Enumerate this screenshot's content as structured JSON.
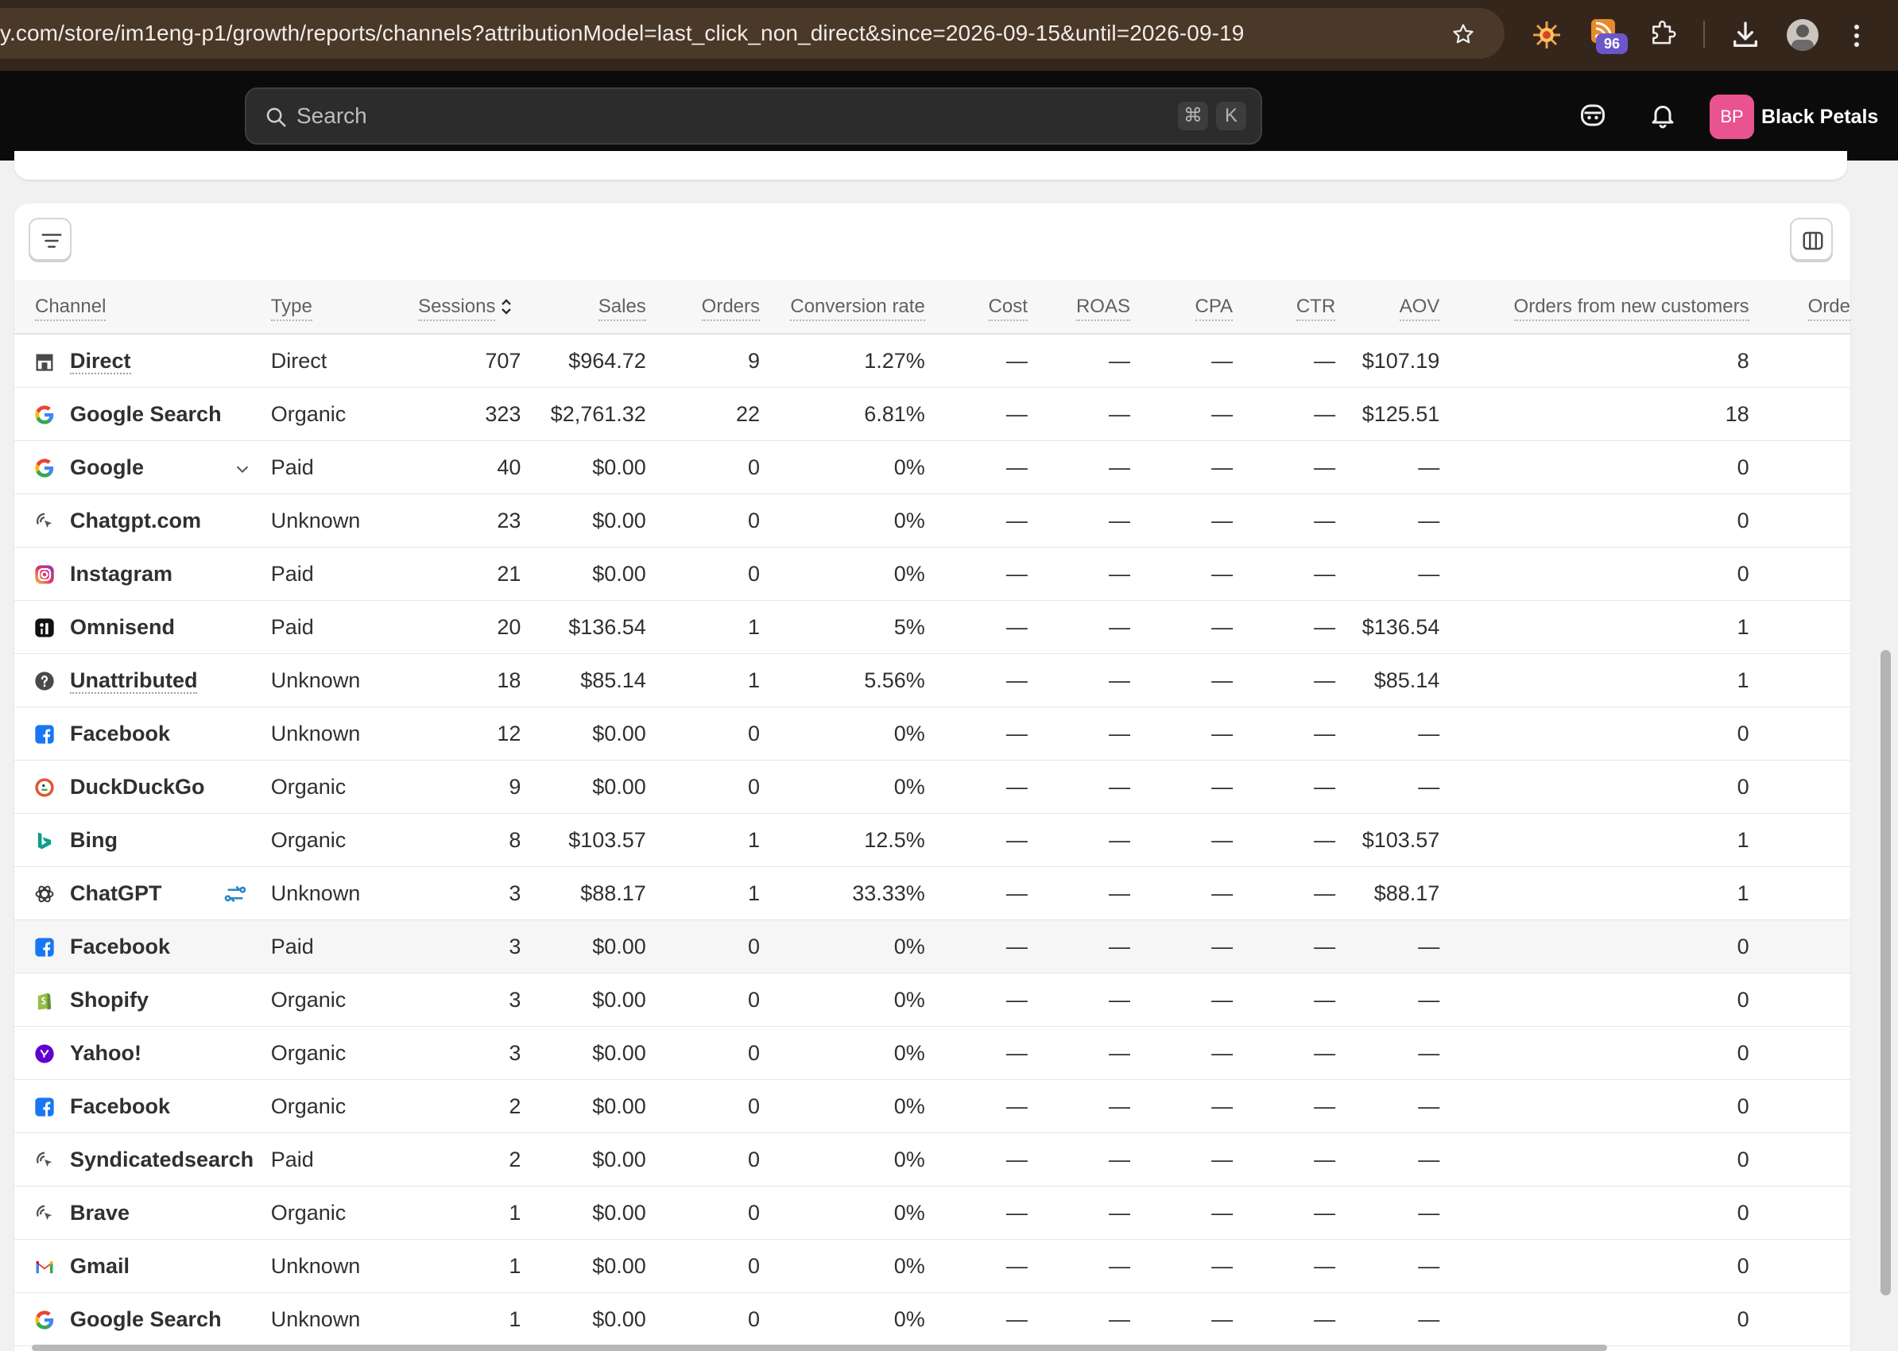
{
  "browser": {
    "url": "y.com/store/im1eng-p1/growth/reports/channels?attributionModel=last_click_non_direct&since=2026-09-15&until=2026-09-19",
    "extension_badge": "96"
  },
  "topbar": {
    "search_placeholder": "Search",
    "shortcut_cmd": "⌘",
    "shortcut_key": "K",
    "store_initials": "BP",
    "store_name": "Black Petals"
  },
  "table": {
    "columns": [
      "Channel",
      "Type",
      "Sessions",
      "Sales",
      "Orders",
      "Conversion rate",
      "Cost",
      "ROAS",
      "CPA",
      "CTR",
      "AOV",
      "Orders from new customers",
      "Orders"
    ],
    "rows": [
      {
        "icon": "store-icon",
        "channel": "Direct",
        "type": "Direct",
        "sessions": "707",
        "sales": "$964.72",
        "orders": "9",
        "conv": "1.27%",
        "cost": "—",
        "roas": "—",
        "cpa": "—",
        "ctr": "—",
        "aov": "$107.19",
        "new_orders": "8"
      },
      {
        "icon": "google-icon",
        "channel": "Google Search",
        "type": "Organic",
        "sessions": "323",
        "sales": "$2,761.32",
        "orders": "22",
        "conv": "6.81%",
        "cost": "—",
        "roas": "—",
        "cpa": "—",
        "ctr": "—",
        "aov": "$125.51",
        "new_orders": "18"
      },
      {
        "icon": "google-icon",
        "channel": "Google",
        "type": "Paid",
        "sessions": "40",
        "sales": "$0.00",
        "orders": "0",
        "conv": "0%",
        "cost": "—",
        "roas": "—",
        "cpa": "—",
        "ctr": "—",
        "aov": "—",
        "new_orders": "0"
      },
      {
        "icon": "cursor-click-icon",
        "channel": "Chatgpt.com",
        "type": "Unknown",
        "sessions": "23",
        "sales": "$0.00",
        "orders": "0",
        "conv": "0%",
        "cost": "—",
        "roas": "—",
        "cpa": "—",
        "ctr": "—",
        "aov": "—",
        "new_orders": "0"
      },
      {
        "icon": "instagram-icon",
        "channel": "Instagram",
        "type": "Paid",
        "sessions": "21",
        "sales": "$0.00",
        "orders": "0",
        "conv": "0%",
        "cost": "—",
        "roas": "—",
        "cpa": "—",
        "ctr": "—",
        "aov": "—",
        "new_orders": "0"
      },
      {
        "icon": "omnisend-icon",
        "channel": "Omnisend",
        "type": "Paid",
        "sessions": "20",
        "sales": "$136.54",
        "orders": "1",
        "conv": "5%",
        "cost": "—",
        "roas": "—",
        "cpa": "—",
        "ctr": "—",
        "aov": "$136.54",
        "new_orders": "1"
      },
      {
        "icon": "question-icon",
        "channel": "Unattributed",
        "type": "Unknown",
        "sessions": "18",
        "sales": "$85.14",
        "orders": "1",
        "conv": "5.56%",
        "cost": "—",
        "roas": "—",
        "cpa": "—",
        "ctr": "—",
        "aov": "$85.14",
        "new_orders": "1"
      },
      {
        "icon": "facebook-icon",
        "channel": "Facebook",
        "type": "Unknown",
        "sessions": "12",
        "sales": "$0.00",
        "orders": "0",
        "conv": "0%",
        "cost": "—",
        "roas": "—",
        "cpa": "—",
        "ctr": "—",
        "aov": "—",
        "new_orders": "0"
      },
      {
        "icon": "duckduckgo-icon",
        "channel": "DuckDuckGo",
        "type": "Organic",
        "sessions": "9",
        "sales": "$0.00",
        "orders": "0",
        "conv": "0%",
        "cost": "—",
        "roas": "—",
        "cpa": "—",
        "ctr": "—",
        "aov": "—",
        "new_orders": "0"
      },
      {
        "icon": "bing-icon",
        "channel": "Bing",
        "type": "Organic",
        "sessions": "8",
        "sales": "$103.57",
        "orders": "1",
        "conv": "12.5%",
        "cost": "—",
        "roas": "—",
        "cpa": "—",
        "ctr": "—",
        "aov": "$103.57",
        "new_orders": "1"
      },
      {
        "icon": "chatgpt-icon",
        "channel": "ChatGPT",
        "type": "Unknown",
        "sessions": "3",
        "sales": "$88.17",
        "orders": "1",
        "conv": "33.33%",
        "cost": "—",
        "roas": "—",
        "cpa": "—",
        "ctr": "—",
        "aov": "$88.17",
        "new_orders": "1"
      },
      {
        "icon": "facebook-icon",
        "channel": "Facebook",
        "type": "Paid",
        "sessions": "3",
        "sales": "$0.00",
        "orders": "0",
        "conv": "0%",
        "cost": "—",
        "roas": "—",
        "cpa": "—",
        "ctr": "—",
        "aov": "—",
        "new_orders": "0"
      },
      {
        "icon": "shopify-icon",
        "channel": "Shopify",
        "type": "Organic",
        "sessions": "3",
        "sales": "$0.00",
        "orders": "0",
        "conv": "0%",
        "cost": "—",
        "roas": "—",
        "cpa": "—",
        "ctr": "—",
        "aov": "—",
        "new_orders": "0"
      },
      {
        "icon": "yahoo-icon",
        "channel": "Yahoo!",
        "type": "Organic",
        "sessions": "3",
        "sales": "$0.00",
        "orders": "0",
        "conv": "0%",
        "cost": "—",
        "roas": "—",
        "cpa": "—",
        "ctr": "—",
        "aov": "—",
        "new_orders": "0"
      },
      {
        "icon": "facebook-icon",
        "channel": "Facebook",
        "type": "Organic",
        "sessions": "2",
        "sales": "$0.00",
        "orders": "0",
        "conv": "0%",
        "cost": "—",
        "roas": "—",
        "cpa": "—",
        "ctr": "—",
        "aov": "—",
        "new_orders": "0"
      },
      {
        "icon": "cursor-click-icon",
        "channel": "Syndicatedsearch",
        "type": "Paid",
        "sessions": "2",
        "sales": "$0.00",
        "orders": "0",
        "conv": "0%",
        "cost": "—",
        "roas": "—",
        "cpa": "—",
        "ctr": "—",
        "aov": "—",
        "new_orders": "0"
      },
      {
        "icon": "cursor-click-icon",
        "channel": "Brave",
        "type": "Organic",
        "sessions": "1",
        "sales": "$0.00",
        "orders": "0",
        "conv": "0%",
        "cost": "—",
        "roas": "—",
        "cpa": "—",
        "ctr": "—",
        "aov": "—",
        "new_orders": "0"
      },
      {
        "icon": "gmail-icon",
        "channel": "Gmail",
        "type": "Unknown",
        "sessions": "1",
        "sales": "$0.00",
        "orders": "0",
        "conv": "0%",
        "cost": "—",
        "roas": "—",
        "cpa": "—",
        "ctr": "—",
        "aov": "—",
        "new_orders": "0"
      },
      {
        "icon": "google-icon",
        "channel": "Google Search",
        "type": "Unknown",
        "sessions": "1",
        "sales": "$0.00",
        "orders": "0",
        "conv": "0%",
        "cost": "—",
        "roas": "—",
        "cpa": "—",
        "ctr": "—",
        "aov": "—",
        "new_orders": "0"
      }
    ]
  }
}
